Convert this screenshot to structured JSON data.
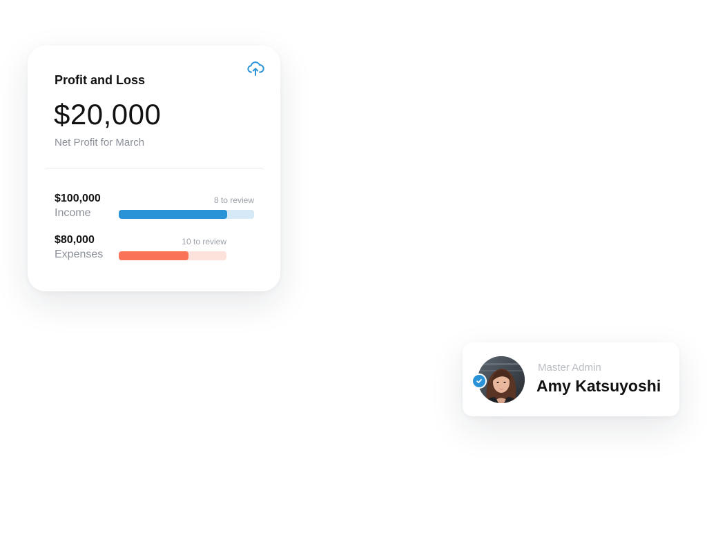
{
  "pl_card": {
    "title": "Profit and Loss",
    "amount": "$20,000",
    "subtitle": "Net Profit for March",
    "upload_icon": "cloud-upload-icon",
    "accent_color": "#2a92d6",
    "metrics": [
      {
        "value": "$100,000",
        "label": "Income",
        "review": "8 to review",
        "progress": 0.8,
        "fill_color": "#2a92d6",
        "track_color": "#d5e9f7"
      },
      {
        "value": "$80,000",
        "label": "Expenses",
        "review": "10 to review",
        "progress": 0.65,
        "fill_color": "#fa7358",
        "track_color": "#fde2dc"
      }
    ]
  },
  "profile_card": {
    "role": "Master Admin",
    "name": "Amy Katsuyoshi",
    "avatar_icon": "user-avatar",
    "verified_icon": "verified-check-icon",
    "badge_color": "#2a92d6"
  }
}
